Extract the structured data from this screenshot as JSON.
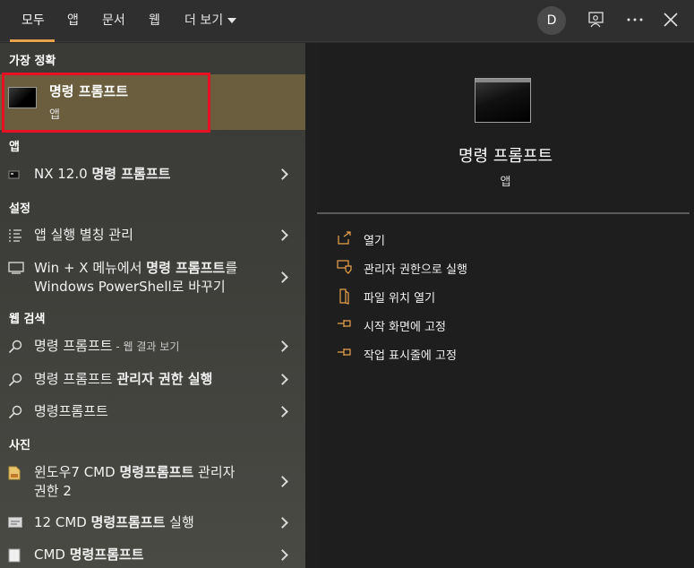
{
  "topbar": {
    "tabs": [
      {
        "label": "모두"
      },
      {
        "label": "앱"
      },
      {
        "label": "문서"
      },
      {
        "label": "웹"
      },
      {
        "label": "더 보기"
      }
    ],
    "avatar_letter": "D"
  },
  "left": {
    "best_match_header": "가장 정확",
    "best_match": {
      "title": "명령 프롬프트",
      "subtitle": "앱"
    },
    "apps_header": "앱",
    "apps": [
      {
        "prefix": "NX 12.0 ",
        "bold": "명령 프롬프트"
      }
    ],
    "settings_header": "설정",
    "settings": [
      {
        "line1": "앱 실행 별칭 관리"
      },
      {
        "line1_prefix": "Win + X 메뉴에서 ",
        "line1_bold": "명령 프롬프트",
        "line1_suffix": "를",
        "line2": "Windows PowerShell로 바꾸기"
      }
    ],
    "web_header": "웹 검색",
    "web": [
      {
        "text": "명령 프롬프트",
        "suffix": " - 웹 결과 보기"
      },
      {
        "text": "명령 프롬프트 ",
        "bold": "관리자 권한 실행"
      },
      {
        "text": "명령프롬프트"
      }
    ],
    "photos_header": "사진",
    "photos": [
      {
        "prefix": "윈도우7 CMD ",
        "bold": "명령프롬프트",
        "suffix": " 관리자",
        "line2": "권한 2"
      },
      {
        "prefix": "12 CMD ",
        "bold": "명령프롬프트",
        "suffix": " 실행"
      },
      {
        "prefix": "CMD ",
        "bold": "명령프롬프트",
        "suffix": ""
      }
    ]
  },
  "detail": {
    "title": "명령 프롬프트",
    "subtitle": "앱",
    "actions": [
      {
        "label": "열기"
      },
      {
        "label": "관리자 권한으로 실행"
      },
      {
        "label": "파일 위치 열기"
      },
      {
        "label": "시작 화면에 고정"
      },
      {
        "label": "작업 표시줄에 고정"
      }
    ]
  },
  "colors": {
    "accent": "#e8a24b",
    "highlight": "#6b5e3e",
    "red_box": "#e81123"
  }
}
